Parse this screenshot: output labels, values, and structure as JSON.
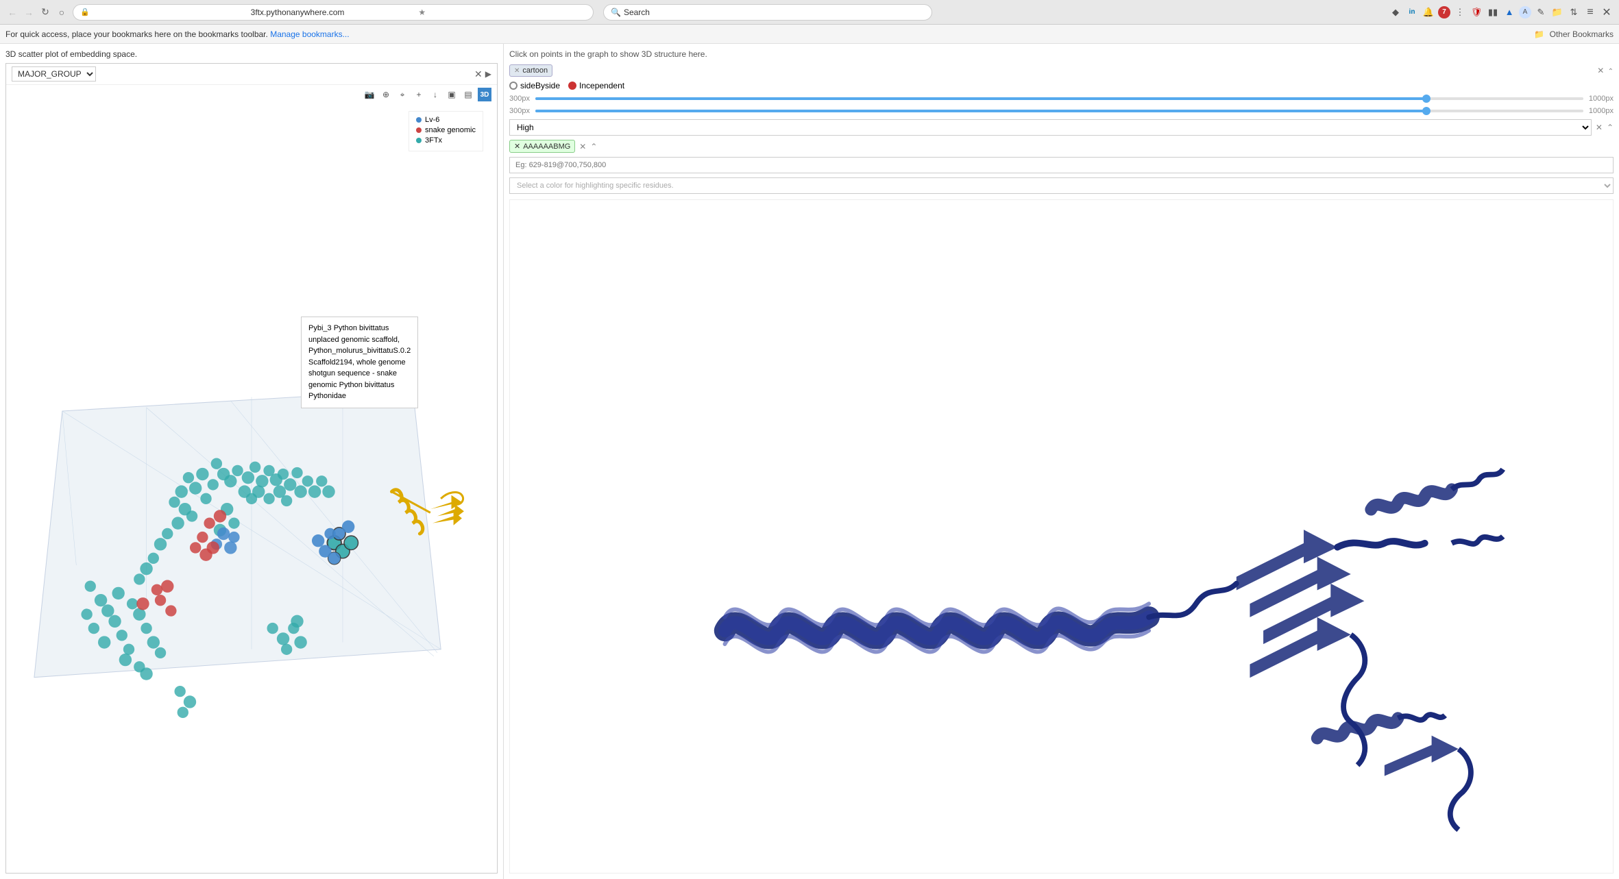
{
  "browser": {
    "url": "3ftx.pythonanywhere.com",
    "search_placeholder": "Search",
    "bookmarks_text": "For quick access, place your bookmarks here on the bookmarks toolbar.",
    "manage_bookmarks_label": "Manage bookmarks...",
    "other_bookmarks_label": "Other Bookmarks"
  },
  "left_panel": {
    "title": "3D scatter plot of embedding space.",
    "dropdown_value": "MAJOR_GROUP",
    "legend": {
      "items": [
        {
          "label": "Lv-6",
          "color": "#4488cc"
        },
        {
          "label": "snake genomic",
          "color": "#cc4444"
        },
        {
          "label": "3FTx",
          "color": "#33aaaa"
        }
      ]
    },
    "tooltip": {
      "name": "Pybi_3 Python bivittatus",
      "line2": "unplaced genomic scaffold,",
      "line3": "Python_molurus_bivittatuS.0.2",
      "line4": "Scaffold2194, whole genome",
      "line5": "shotgun sequence - snake",
      "line6": "genomic Python bivittatus",
      "line7": "Pythonidae"
    }
  },
  "right_panel": {
    "header": "Click on points in the graph to show 3D structure here.",
    "style_tag": "cartoon",
    "view_options": [
      {
        "label": "sideByside",
        "selected": false
      },
      {
        "label": "Incependent",
        "selected": true
      }
    ],
    "slider1": {
      "min_label": "300px",
      "max_label": "1000px",
      "value_percent": 85
    },
    "slider2": {
      "min_label": "300px",
      "max_label": "1000px",
      "value_percent": 85
    },
    "quality_label": "High",
    "sequence_tag": "AAAAAABMG",
    "residue_placeholder": "Eg: 629-819@700,750,800",
    "color_placeholder": "Select a color for highlighting specific residues."
  }
}
